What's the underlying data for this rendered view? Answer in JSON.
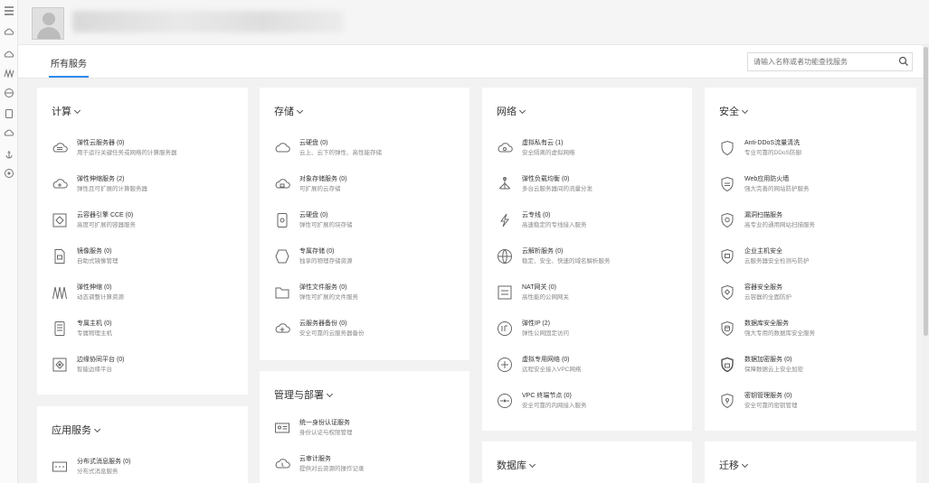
{
  "tabs": {
    "active": "所有服务"
  },
  "search": {
    "placeholder": "请输入名称或者功能查找服务"
  },
  "categories": [
    {
      "title": "计算",
      "items": [
        {
          "name": "弹性云服务器 (0)",
          "desc": "用于运行关键任务或网络的计算服务器",
          "icon": "cloud-server-icon"
        },
        {
          "name": "弹性伸缩服务 (2)",
          "desc": "弹性且可扩展的计算服务器",
          "icon": "cloud-scale-icon"
        },
        {
          "name": "云容器引擎 CCE (0)",
          "desc": "高度可扩展的容器服务",
          "icon": "container-icon"
        },
        {
          "name": "镜像服务 (0)",
          "desc": "自助式镜像管理",
          "icon": "image-file-icon"
        },
        {
          "name": "弹性伸缩 (0)",
          "desc": "动态调整计算资源",
          "icon": "autoscale-icon"
        },
        {
          "name": "专属主机 (0)",
          "desc": "专属物理主机",
          "icon": "dedicated-host-icon"
        },
        {
          "name": "边缘协同平台 (0)",
          "desc": "智能边缘平台",
          "icon": "edge-platform-icon"
        }
      ]
    },
    {
      "title": "存储",
      "items": [
        {
          "name": "云硬盘 (0)",
          "desc": "云上、云下的弹性、高性能存储",
          "icon": "cloud-disk-icon"
        },
        {
          "name": "对象存储服务 (0)",
          "desc": "可扩展的云存储",
          "icon": "object-storage-icon"
        },
        {
          "name": "云硬盘 (0)",
          "desc": "弹性可扩展的块存储",
          "icon": "disk-icon"
        },
        {
          "name": "专属存储 (0)",
          "desc": "独享的物理存储资源",
          "icon": "dedicated-storage-icon"
        },
        {
          "name": "弹性文件服务 (0)",
          "desc": "弹性可扩展的文件服务",
          "icon": "folder-icon"
        },
        {
          "name": "云服务器备份 (0)",
          "desc": "安全可靠的云服务器备份",
          "icon": "backup-icon"
        }
      ]
    },
    {
      "title": "网络",
      "items": [
        {
          "name": "虚拟私有云 (1)",
          "desc": "安全隔离的虚拟网络",
          "icon": "vpc-icon"
        },
        {
          "name": "弹性负载均衡 (0)",
          "desc": "多台云服务器间的流量分发",
          "icon": "load-balance-icon"
        },
        {
          "name": "云专线 (0)",
          "desc": "高速稳定的专线接入服务",
          "icon": "direct-connect-icon"
        },
        {
          "name": "云解析服务 (0)",
          "desc": "稳定、安全、快速的域名解析服务",
          "icon": "dns-icon"
        },
        {
          "name": "NAT网关 (0)",
          "desc": "高性能的公网网关",
          "icon": "nat-gateway-icon"
        },
        {
          "name": "弹性IP (2)",
          "desc": "弹性公网固定访问",
          "icon": "eip-icon"
        },
        {
          "name": "虚拟专用网络 (0)",
          "desc": "远程安全接入VPC网络",
          "icon": "vpn-icon"
        },
        {
          "name": "VPC 终端节点 (0)",
          "desc": "安全可靠的内网接入服务",
          "icon": "vpc-endpoint-icon"
        }
      ]
    },
    {
      "title": "安全",
      "items": [
        {
          "name": "Anti-DDoS流量清洗",
          "desc": "专业可靠的DDoS防御",
          "icon": "shield-icon"
        },
        {
          "name": "Web应用防火墙",
          "desc": "强大完善的网站防护服务",
          "icon": "firewall-shield-icon"
        },
        {
          "name": "漏洞扫描服务",
          "desc": "高专业的通用网站扫描服务",
          "icon": "scan-shield-icon"
        },
        {
          "name": "企业主机安全",
          "desc": "云服务器安全检测与防护",
          "icon": "host-security-icon"
        },
        {
          "name": "容器安全服务",
          "desc": "云容器的全面防护",
          "icon": "container-security-icon"
        },
        {
          "name": "数据库安全服务",
          "desc": "强大专用的数据库安全服务",
          "icon": "db-security-icon"
        },
        {
          "name": "数据加密服务 (0)",
          "desc": "保障数据云上安全加密",
          "icon": "encryption-icon"
        },
        {
          "name": "密钥管理服务 (0)",
          "desc": "安全可靠的密钥管理",
          "icon": "key-management-icon"
        }
      ]
    },
    {
      "title": "应用服务",
      "items": [
        {
          "name": "分布式消息服务 (0)",
          "desc": "分布式消息服务",
          "icon": "message-queue-icon"
        }
      ]
    },
    {
      "title": "管理与部署",
      "items": [
        {
          "name": "统一身份认证服务",
          "desc": "身份认证与权限管理",
          "icon": "identity-icon"
        },
        {
          "name": "云审计服务",
          "desc": "提供对云资源的操作记录",
          "icon": "audit-icon"
        }
      ]
    },
    {
      "title": "数据库",
      "items": []
    },
    {
      "title": "迁移",
      "items": []
    }
  ]
}
